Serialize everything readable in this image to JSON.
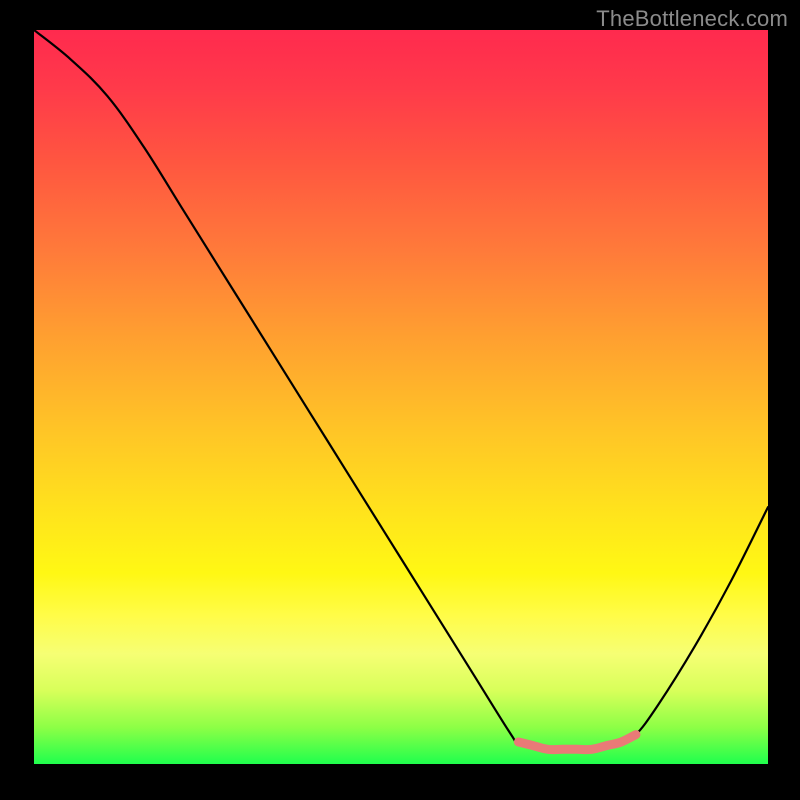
{
  "watermark": "TheBottleneck.com",
  "chart_data": {
    "type": "line",
    "title": "",
    "xlabel": "",
    "ylabel": "",
    "xlim": [
      0,
      100
    ],
    "ylim": [
      0,
      100
    ],
    "grid": false,
    "series": [
      {
        "name": "bottleneck-curve",
        "x": [
          0,
          5,
          10,
          15,
          20,
          25,
          30,
          35,
          40,
          45,
          50,
          55,
          60,
          65,
          66,
          70,
          75,
          80,
          82,
          85,
          90,
          95,
          100
        ],
        "y": [
          100,
          96,
          91,
          84,
          76,
          68,
          60,
          52,
          44,
          36,
          28,
          20,
          12,
          4,
          3,
          2,
          2,
          3,
          4,
          8,
          16,
          25,
          35
        ]
      },
      {
        "name": "optimal-band",
        "x": [
          66,
          68,
          70,
          72,
          74,
          76,
          78,
          80,
          82
        ],
        "y": [
          3,
          2.5,
          2,
          2,
          2,
          2,
          2.5,
          3,
          4
        ]
      }
    ],
    "annotations": []
  },
  "colors": {
    "curve": "#000000",
    "optimal_marker": "#e97a77",
    "gradient_top": "#ff2a4e",
    "gradient_bottom": "#1fff4d",
    "background": "#000000",
    "watermark": "#8b8b8b"
  }
}
